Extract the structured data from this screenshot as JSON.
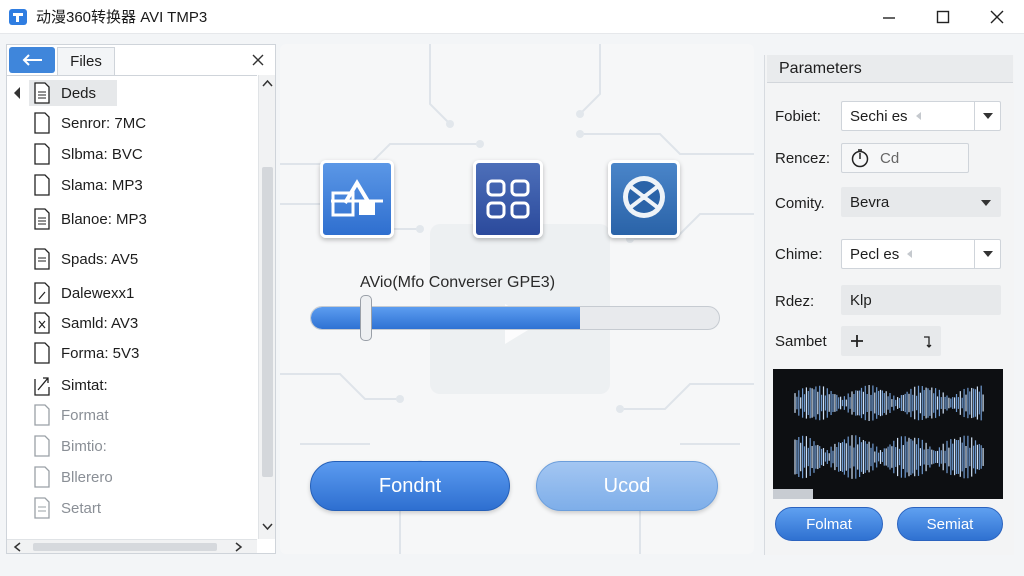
{
  "window": {
    "title": "动漫360转换器 AVI TMP3",
    "minimize_icon": "minimize-icon",
    "maximize_icon": "maximize-icon",
    "close_icon": "close-icon"
  },
  "files_panel": {
    "tab_label": "Files",
    "back_icon": "arrow-left-icon",
    "close_icon": "close-icon",
    "items": [
      {
        "label": "Deds",
        "icon": "document-lines-icon"
      },
      {
        "label": "Senror: 7MC",
        "icon": "document-icon"
      },
      {
        "label": "Slbma: BVC",
        "icon": "document-icon"
      },
      {
        "label": "Slama: MP3",
        "icon": "document-icon"
      },
      {
        "label": "Blanoe: MP3",
        "icon": "document-lines-icon"
      },
      {
        "label": "Spads: AV5",
        "icon": "document-lines-icon"
      },
      {
        "label": "Dalewexx1",
        "icon": "document-edit-icon"
      },
      {
        "label": "Samld: AV3",
        "icon": "document-x-icon"
      },
      {
        "label": "Forma: 5V3",
        "icon": "document-icon"
      },
      {
        "label": "Simtat:",
        "icon": "export-icon"
      },
      {
        "label": "Format",
        "icon": "document-icon"
      },
      {
        "label": "Bimtio:",
        "icon": "document-icon"
      },
      {
        "label": "Bllerero",
        "icon": "document-icon"
      },
      {
        "label": "Setart",
        "icon": "document-lines-icon"
      }
    ]
  },
  "center": {
    "tools": [
      {
        "name": "edit-tool",
        "icon": "film-edit-icon"
      },
      {
        "name": "grid-tool",
        "icon": "grid-icon"
      },
      {
        "name": "disc-tool",
        "icon": "disc-icon"
      }
    ],
    "conversion_label": "AVio(Mfo Converser GPE3)",
    "progress": 0.66,
    "primary_button": "Fondnt",
    "secondary_button": "Ucod"
  },
  "parameters": {
    "header": "Parameters",
    "rows": [
      {
        "label": "Fobiet:",
        "value": "Sechi es",
        "control": "dropdown"
      },
      {
        "label": "Rencez:",
        "value": "Cd",
        "control": "input-with-icon",
        "icon": "timer-icon"
      },
      {
        "label": "Comity.",
        "value": "Bevra",
        "control": "dropdown"
      },
      {
        "label": "Chime:",
        "value": "Pecl es",
        "control": "dropdown"
      },
      {
        "label": "Rdez:",
        "value": "Klp",
        "control": "text"
      },
      {
        "label": "Sambet",
        "value": "",
        "control": "add-button"
      }
    ],
    "buttons": [
      "Folmat",
      "Semiat"
    ]
  },
  "colors": {
    "accent": "#2f72d3",
    "accent_light": "#7eaee9",
    "waveform_bg": "#0d0f12"
  }
}
